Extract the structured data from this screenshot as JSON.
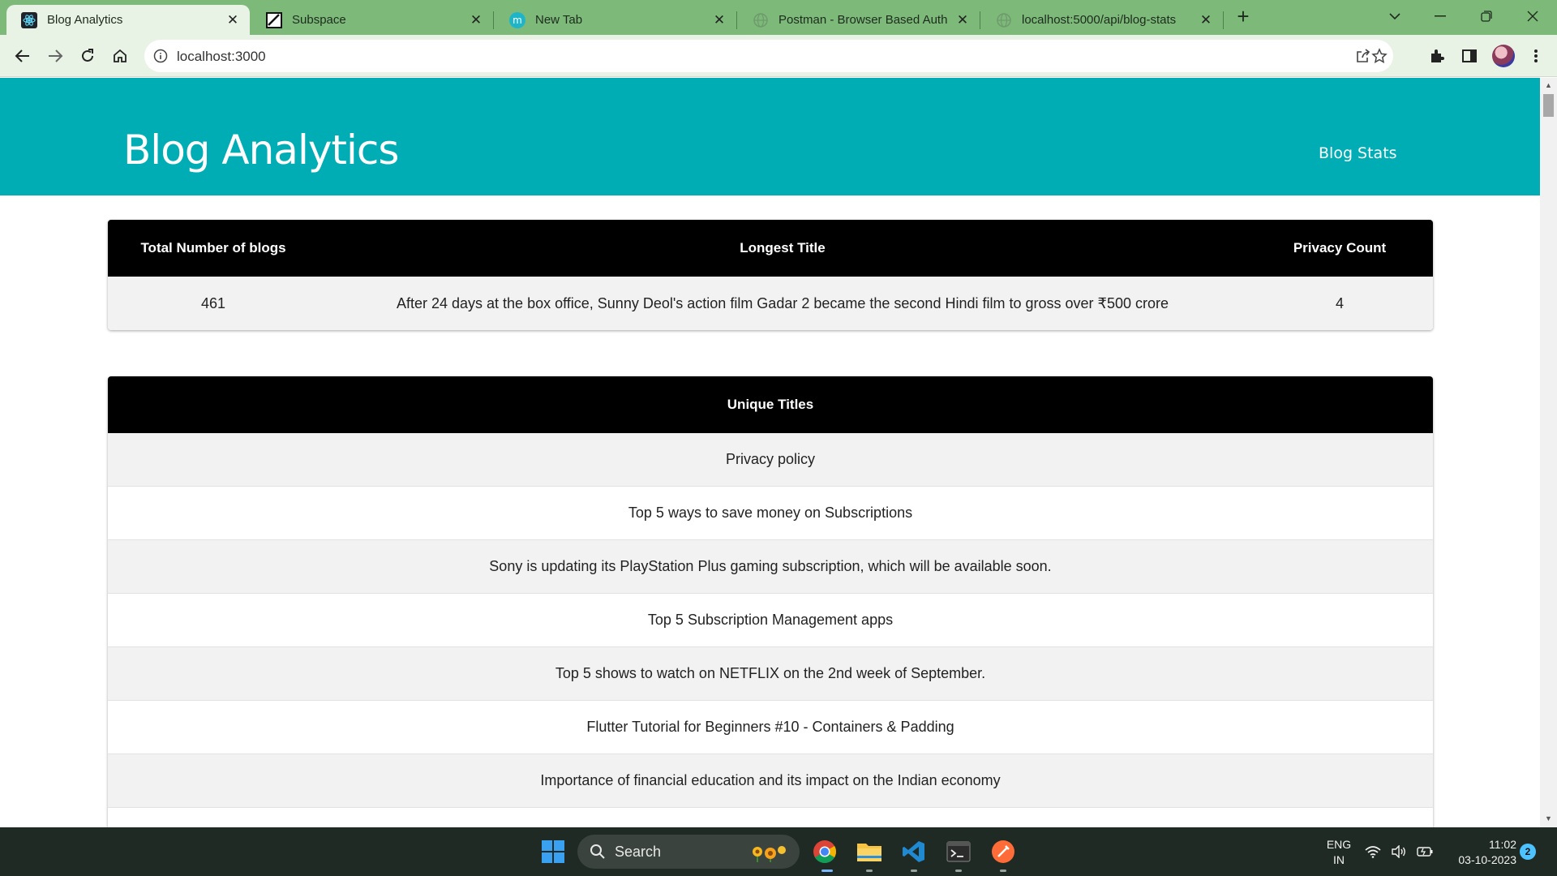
{
  "browser": {
    "tabs": [
      {
        "label": "Blog Analytics",
        "icon": "react-icon",
        "active": true
      },
      {
        "label": "Subspace",
        "icon": "subspace-icon",
        "active": false
      },
      {
        "label": "New Tab",
        "icon": "m-icon",
        "active": false
      },
      {
        "label": "Postman - Browser Based Auth",
        "icon": "globe-icon",
        "active": false
      },
      {
        "label": "localhost:5000/api/blog-stats",
        "icon": "globe-icon",
        "active": false
      }
    ],
    "url": "localhost:3000"
  },
  "page": {
    "site_title": "Blog Analytics",
    "nav_link": "Blog Stats",
    "stats_table": {
      "headers": [
        "Total Number of blogs",
        "Longest Title",
        "Privacy Count"
      ],
      "row": [
        "461",
        "After 24 days at the box office, Sunny Deol's action film Gadar 2 became the second Hindi film to gross over ₹500 crore",
        "4"
      ]
    },
    "titles_table": {
      "header": "Unique Titles",
      "rows": [
        "Privacy policy",
        "Top 5 ways to save money on Subscriptions",
        "Sony is updating its PlayStation Plus gaming subscription, which will be available soon.",
        "Top 5 Subscription Management apps",
        "Top 5 shows to watch on NETFLIX on the 2nd week of September.",
        "Flutter Tutorial for Beginners #10 - Containers & Padding",
        "Importance of financial education and its impact on the Indian economy"
      ]
    },
    "colors": {
      "header_bg": "#00adb5",
      "table_header_bg": "#000000",
      "tab_bar": "#7dba7a"
    }
  },
  "taskbar": {
    "search_label": "Search",
    "lang_line1": "ENG",
    "lang_line2": "IN",
    "time": "11:02",
    "date": "03-10-2023",
    "notification_count": "2"
  }
}
